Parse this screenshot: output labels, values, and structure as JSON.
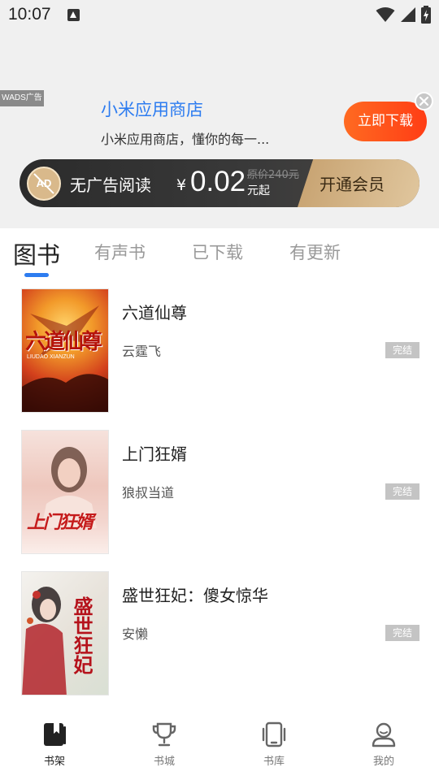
{
  "status_bar": {
    "time": "10:07"
  },
  "ad": {
    "tag": "WADS广告",
    "title": "小米应用商店",
    "description": "小米应用商店，懂你的每一...",
    "download_label": "立即下载"
  },
  "vip": {
    "icon_text": "AD",
    "label": "无广告阅读",
    "currency": "¥",
    "price": "0.02",
    "unit": "元起",
    "original_price": "原价240元",
    "open_label": "开通会员"
  },
  "tabs": [
    {
      "label": "图书",
      "active": true
    },
    {
      "label": "有声书"
    },
    {
      "label": "已下载"
    },
    {
      "label": "有更新"
    }
  ],
  "books": [
    {
      "title": "六道仙尊",
      "author": "云霆飞",
      "status": "完结",
      "cover_text": "六道仙尊",
      "cover_sub": "LIUDAO XIANZUN"
    },
    {
      "title": "上门狂婿",
      "author": "狼叔当道",
      "status": "完结",
      "cover_text": "上门狂婿"
    },
    {
      "title": "盛世狂妃：傻女惊华",
      "author": "安懒",
      "status": "完结",
      "cover_text": "盛世狂妃"
    }
  ],
  "bottom_nav": [
    {
      "label": "书架",
      "icon": "bookshelf-icon",
      "active": true
    },
    {
      "label": "书城",
      "icon": "trophy-icon"
    },
    {
      "label": "书库",
      "icon": "tablet-icon"
    },
    {
      "label": "我的",
      "icon": "user-icon"
    }
  ],
  "colors": {
    "accent": "#2d7cf0",
    "download_button": "#ff4f1a",
    "vip_gold": "#d6b587",
    "status_badge": "#c4c4c4"
  }
}
